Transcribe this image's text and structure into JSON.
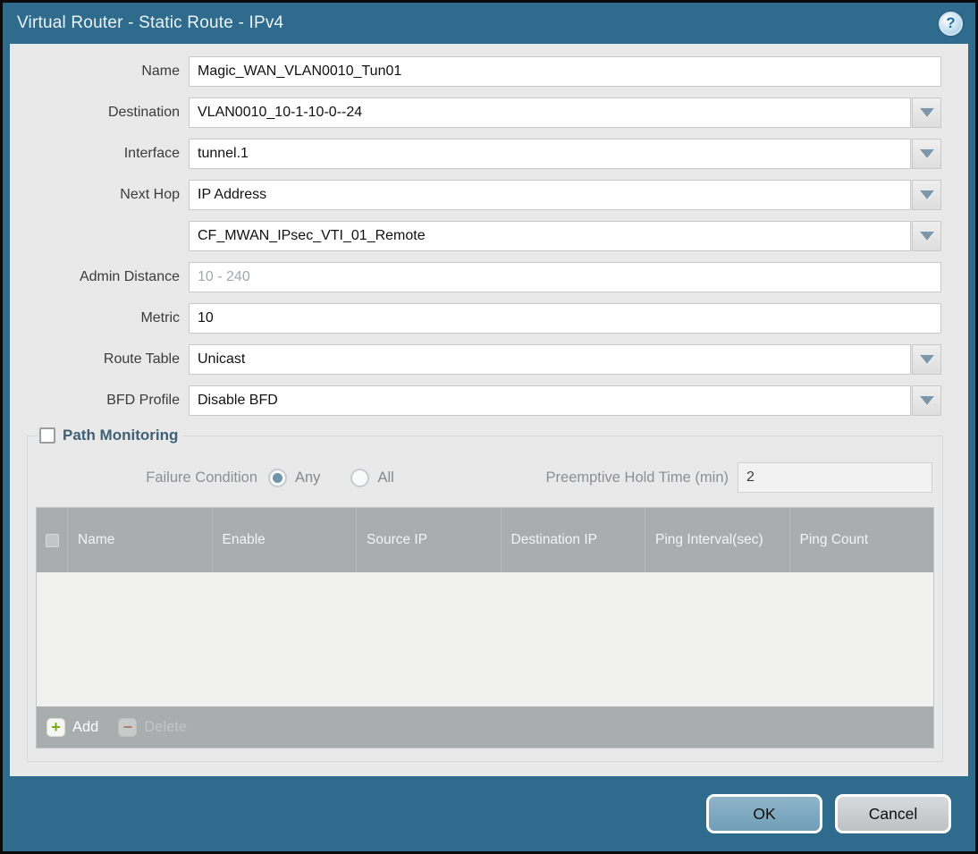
{
  "window": {
    "title": "Virtual Router - Static Route - IPv4",
    "help_glyph": "?"
  },
  "form": {
    "rows": [
      {
        "label": "Name",
        "value": "Magic_WAN_VLAN0010_Tun01"
      },
      {
        "label": "Destination",
        "value": "VLAN0010_10-1-10-0--24"
      },
      {
        "label": "Interface",
        "value": "tunnel.1"
      },
      {
        "label": "Next Hop",
        "value": "IP Address"
      },
      {
        "label": "",
        "value": "CF_MWAN_IPsec_VTI_01_Remote"
      },
      {
        "label": "Admin Distance",
        "value": "",
        "placeholder": "10 - 240"
      },
      {
        "label": "Metric",
        "value": "10"
      },
      {
        "label": "Route Table",
        "value": "Unicast"
      },
      {
        "label": "BFD Profile",
        "value": "Disable BFD"
      }
    ]
  },
  "path_monitoring": {
    "title": "Path Monitoring",
    "checkbox_checked": false,
    "failure_condition_label": "Failure Condition",
    "options": [
      {
        "label": "Any",
        "selected": true
      },
      {
        "label": "All",
        "selected": false
      }
    ],
    "preemptive_label": "Preemptive Hold Time (min)",
    "preemptive_value": "2",
    "table": {
      "columns": [
        "Name",
        "Enable",
        "Source IP",
        "Destination IP",
        "Ping Interval(sec)",
        "Ping Count"
      ],
      "rows": []
    },
    "add_label": "Add",
    "delete_label": "Delete"
  },
  "footer": {
    "ok_label": "OK",
    "cancel_label": "Cancel"
  },
  "colors": {
    "frame_teal": "#2f6b8c",
    "content_bg": "#e9e9e9",
    "table_header_gray": "#a9adad",
    "ok_button": "#6f9fb8",
    "pm_title": "#3f6075",
    "add_plus_green": "#7ca81e",
    "delete_minus_red": "#b2582f"
  }
}
